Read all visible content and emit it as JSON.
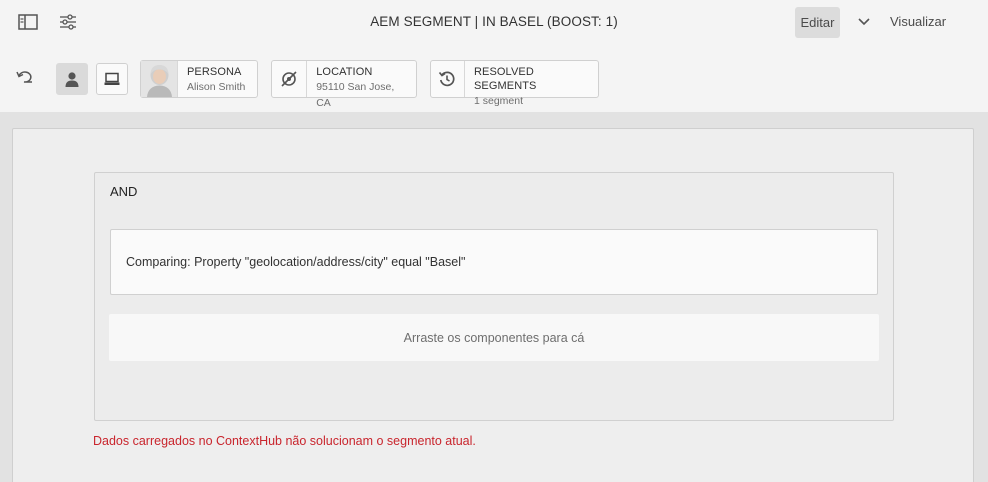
{
  "header": {
    "title": "AEM SEGMENT | IN BASEL (BOOST: 1)",
    "edit_label": "Editar",
    "preview_label": "Visualizar",
    "icons": [
      "side-panel-icon",
      "properties-icon",
      "chevron-down-icon"
    ]
  },
  "toolbar": {
    "icons": [
      "undo-icon",
      "persona-icon",
      "device-icon"
    ],
    "cards": [
      {
        "label": "PERSONA",
        "value": "Alison Smith",
        "icon": "avatar"
      },
      {
        "label": "LOCATION",
        "value": "95110 San Jose, CA",
        "icon": "location-icon"
      },
      {
        "label": "RESOLVED SEGMENTS",
        "value": "1 segment",
        "icon": "refresh-icon"
      }
    ]
  },
  "segment": {
    "container_label": "AND",
    "rule_text": "Comparing: Property \"geolocation/address/city\" equal \"Basel\"",
    "dropzone_text": "Arraste os componentes para cá",
    "error_text": "Dados carregados no ContextHub não solucionam o segmento atual."
  },
  "colors": {
    "error": "#c9252d",
    "chrome_bg": "#f4f4f4",
    "canvas_bg": "#eeeeee"
  }
}
